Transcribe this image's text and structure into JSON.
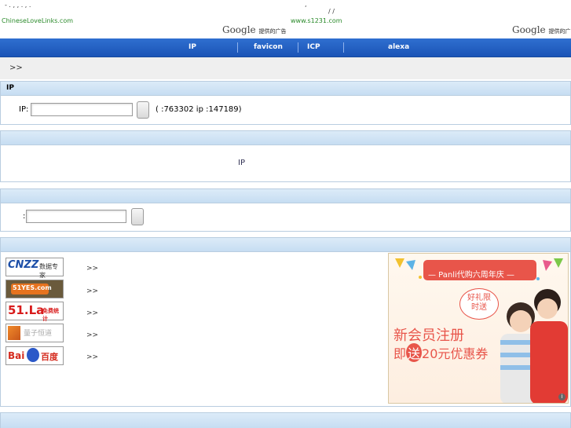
{
  "topbar": {
    "dots_left": "- . , , . , .",
    "dot_center": ",",
    "slashes": "/ /",
    "site_left": "ChineseLoveLinks.com",
    "site_right": "www.s1231.com",
    "google_brand": "Google",
    "ads_by": "提供的广告"
  },
  "nav": {
    "items": [
      "IP",
      "favicon",
      "ICP",
      "alexa"
    ]
  },
  "breadcrumb": ">>",
  "ip_panel": {
    "title": "IP",
    "input_label": "IP:",
    "input_value": "",
    "stats": "(  :763302  ip :147189)"
  },
  "panel2": {
    "title": "",
    "center_text": "IP"
  },
  "panel3": {
    "title": "",
    "input_label": ":",
    "input_value": ""
  },
  "stats_panel": {
    "title": "",
    "logos": [
      {
        "name": "cnzz",
        "text": "CNZZ",
        "sub": "数据专家"
      },
      {
        "name": "51yes",
        "text": "51YES.com",
        "sub": ""
      },
      {
        "name": "51la",
        "text": "51.La",
        "sub": "免费统计"
      },
      {
        "name": "linezing",
        "text": "量子恒道",
        "sub": ""
      },
      {
        "name": "baidu",
        "text": "Bai",
        "sub": "百度"
      }
    ],
    "arrow": ">>"
  },
  "ad": {
    "banner": "— Panli代购六周年庆 —",
    "bubble": "好礼限时送",
    "line1": "新会员注册",
    "line2_pre": "即",
    "line2_hl": "送",
    "line2_post": "20元优惠券",
    "info_icon": "i"
  },
  "colors": {
    "nav_blue": "#1f5cc0",
    "panel_head": "#cfe2f4",
    "ad_red": "#e8554a"
  }
}
